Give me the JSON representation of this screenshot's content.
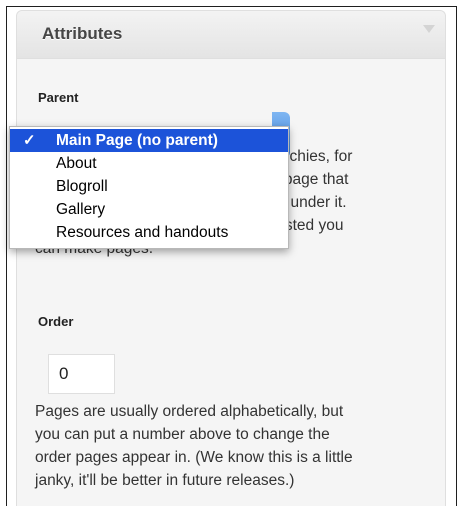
{
  "panel": {
    "title": "Attributes"
  },
  "parent": {
    "label": "Parent",
    "selected": "Main Page (no parent)",
    "options": [
      "Main Page (no parent)",
      "About",
      "Blogroll",
      "Gallery",
      "Resources and handouts"
    ],
    "help_lines": [
      "You can arrange your pages in hierarchies, for",
      "example you could have an \"About\" page that",
      "has \"Life Story\" and \"My Dog\" pages under it.",
      "There are no limits to how deeply nested you",
      "can make pages."
    ]
  },
  "order": {
    "label": "Order",
    "value": "0",
    "help_lines": [
      "Pages are usually ordered alphabetically, but",
      "you can put a number above to change the",
      "order pages appear in. (We know this is a little",
      "janky, it'll be better in future releases.)"
    ]
  },
  "icons": {
    "check": "checkmark-icon",
    "toggle": "collapse-arrow-icon"
  }
}
